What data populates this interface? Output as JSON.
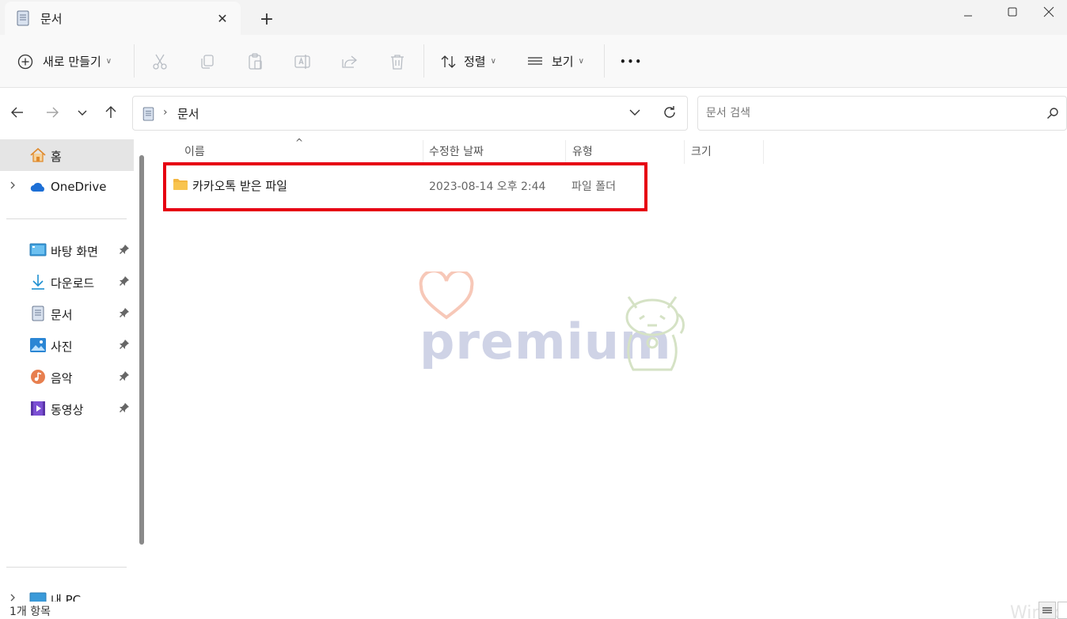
{
  "window": {
    "tab_title": "문서",
    "new_tab_glyph": "+",
    "close_glyph": "✕"
  },
  "commandbar": {
    "new_label": "새로 만들기",
    "sort_label": "정렬",
    "view_label": "보기",
    "more_glyph": "•••"
  },
  "address": {
    "crumb": "문서",
    "separator": "›"
  },
  "search": {
    "placeholder": "문서 검색"
  },
  "sidebar": {
    "home": "홈",
    "onedrive": "OneDrive",
    "pinned": [
      {
        "label": "바탕 화면",
        "icon": "desktop-icon"
      },
      {
        "label": "다운로드",
        "icon": "download-icon"
      },
      {
        "label": "문서",
        "icon": "documents-icon"
      },
      {
        "label": "사진",
        "icon": "pictures-icon"
      },
      {
        "label": "음악",
        "icon": "music-icon"
      },
      {
        "label": "동영상",
        "icon": "videos-icon"
      }
    ],
    "this_pc": "내 PC"
  },
  "columns": {
    "name": "이름",
    "date": "수정한 날짜",
    "type": "유형",
    "size": "크기"
  },
  "files": [
    {
      "name": "카카오톡 받은 파일",
      "date": "2023-08-14 오후 2:44",
      "type": "파일 폴더",
      "size": ""
    }
  ],
  "watermark": {
    "text": "premium"
  },
  "status": {
    "count": "1개 항목",
    "os_watermark": "Windo"
  },
  "colors": {
    "highlight": "#e60012",
    "folder": "#f8c44f",
    "onedrive": "#1d6fd6"
  }
}
